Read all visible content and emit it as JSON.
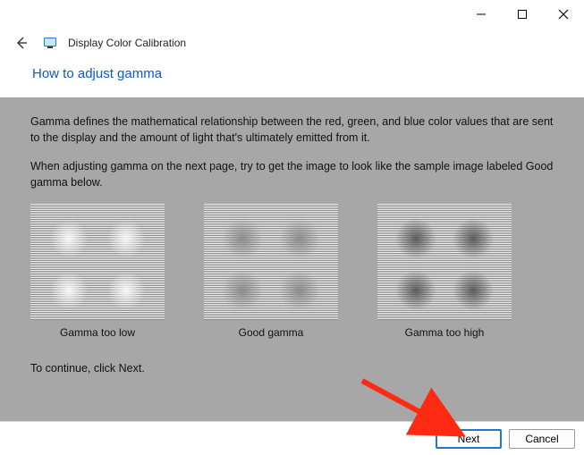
{
  "window": {
    "app_title": "Display Color Calibration",
    "heading": "How to adjust gamma"
  },
  "content": {
    "paragraph1": "Gamma defines the mathematical relationship between the red, green, and blue color values that are sent to the display and the amount of light that's ultimately emitted from it.",
    "paragraph2": "When adjusting gamma on the next page, try to get the image to look like the sample image labeled Good gamma below.",
    "samples": [
      {
        "label": "Gamma too low"
      },
      {
        "label": "Good gamma"
      },
      {
        "label": "Gamma too high"
      }
    ],
    "continue": "To continue, click Next."
  },
  "footer": {
    "next": "Next",
    "cancel": "Cancel"
  },
  "annotation": {
    "arrow_color": "#ff2a12"
  }
}
